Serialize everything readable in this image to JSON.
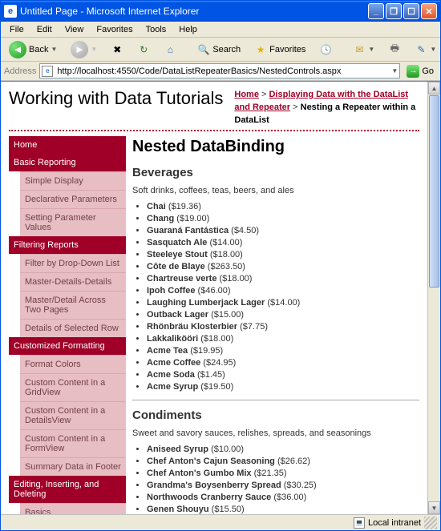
{
  "window": {
    "title": "Untitled Page - Microsoft Internet Explorer"
  },
  "menu": {
    "file": "File",
    "edit": "Edit",
    "view": "View",
    "favorites": "Favorites",
    "tools": "Tools",
    "help": "Help"
  },
  "toolbar": {
    "back": "Back",
    "search": "Search",
    "favorites": "Favorites"
  },
  "address": {
    "label": "Address",
    "url": "http://localhost:4550/Code/DataListRepeaterBasics/NestedControls.aspx",
    "go": "Go"
  },
  "hdr": {
    "title": "Working with Data Tutorials"
  },
  "breadcrumb": {
    "home": "Home",
    "section": "Displaying Data with the DataList and Repeater",
    "current": "Nesting a Repeater within a DataList"
  },
  "side": {
    "home": "Home",
    "cats": [
      {
        "label": "Basic Reporting",
        "items": [
          "Simple Display",
          "Declarative Parameters",
          "Setting Parameter Values"
        ]
      },
      {
        "label": "Filtering Reports",
        "items": [
          "Filter by Drop-Down List",
          "Master-Details-Details",
          "Master/Detail Across Two Pages",
          "Details of Selected Row"
        ]
      },
      {
        "label": "Customized Formatting",
        "items": [
          "Format Colors",
          "Custom Content in a GridView",
          "Custom Content in a DetailsView",
          "Custom Content in a FormView",
          "Summary Data in Footer"
        ]
      },
      {
        "label": "Editing, Inserting, and Deleting",
        "items": [
          "Basics"
        ]
      }
    ]
  },
  "main": {
    "heading": "Nested DataBinding",
    "sections": [
      {
        "title": "Beverages",
        "desc": "Soft drinks, coffees, teas, beers, and ales",
        "products": [
          {
            "name": "Chai",
            "price": "$19.36"
          },
          {
            "name": "Chang",
            "price": "$19.00"
          },
          {
            "name": "Guaraná Fantástica",
            "price": "$4.50"
          },
          {
            "name": "Sasquatch Ale",
            "price": "$14.00"
          },
          {
            "name": "Steeleye Stout",
            "price": "$18.00"
          },
          {
            "name": "Côte de Blaye",
            "price": "$263.50"
          },
          {
            "name": "Chartreuse verte",
            "price": "$18.00"
          },
          {
            "name": "Ipoh Coffee",
            "price": "$46.00"
          },
          {
            "name": "Laughing Lumberjack Lager",
            "price": "$14.00"
          },
          {
            "name": "Outback Lager",
            "price": "$15.00"
          },
          {
            "name": "Rhönbräu Klosterbier",
            "price": "$7.75"
          },
          {
            "name": "Lakkalikööri",
            "price": "$18.00"
          },
          {
            "name": "Acme Tea",
            "price": "$19.95"
          },
          {
            "name": "Acme Coffee",
            "price": "$24.95"
          },
          {
            "name": "Acme Soda",
            "price": "$1.45"
          },
          {
            "name": "Acme Syrup",
            "price": "$19.50"
          }
        ]
      },
      {
        "title": "Condiments",
        "desc": "Sweet and savory sauces, relishes, spreads, and seasonings",
        "products": [
          {
            "name": "Aniseed Syrup",
            "price": "$10.00"
          },
          {
            "name": "Chef Anton's Cajun Seasoning",
            "price": "$26.62"
          },
          {
            "name": "Chef Anton's Gumbo Mix",
            "price": "$21.35"
          },
          {
            "name": "Grandma's Boysenberry Spread",
            "price": "$30.25"
          },
          {
            "name": "Northwoods Cranberry Sauce",
            "price": "$36.00"
          },
          {
            "name": "Genen Shouyu",
            "price": "$15.50"
          }
        ]
      }
    ]
  },
  "status": {
    "zone": "Local intranet"
  }
}
